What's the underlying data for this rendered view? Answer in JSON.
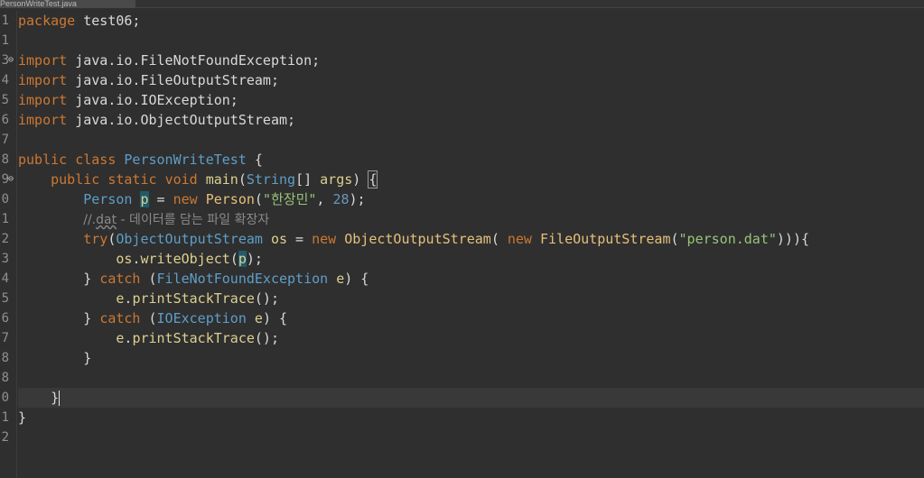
{
  "editor_tab": {
    "label": "PersonWriteTest.java"
  },
  "lines": [
    {
      "n": "1",
      "tokens": [
        {
          "t": "package",
          "c": "kw"
        },
        {
          "t": " test06;",
          "c": "var"
        }
      ]
    },
    {
      "n": "1",
      "tokens": []
    },
    {
      "n": "3",
      "fold": "⊖",
      "tokens": [
        {
          "t": "import",
          "c": "kw"
        },
        {
          "t": " java.io.FileNotFoundException;",
          "c": "var"
        }
      ]
    },
    {
      "n": "4",
      "tokens": [
        {
          "t": "import",
          "c": "kw"
        },
        {
          "t": " java.io.FileOutputStream;",
          "c": "var"
        }
      ]
    },
    {
      "n": "5",
      "tokens": [
        {
          "t": "import",
          "c": "kw"
        },
        {
          "t": " java.io.IOException;",
          "c": "var"
        }
      ]
    },
    {
      "n": "6",
      "tokens": [
        {
          "t": "import",
          "c": "kw"
        },
        {
          "t": " java.io.ObjectOutputStream;",
          "c": "var"
        }
      ]
    },
    {
      "n": "7",
      "tokens": []
    },
    {
      "n": "8",
      "tokens": [
        {
          "t": "public",
          "c": "kw"
        },
        {
          "t": " ",
          "c": "var"
        },
        {
          "t": "class",
          "c": "kw"
        },
        {
          "t": " ",
          "c": "var"
        },
        {
          "t": "PersonWriteTest",
          "c": "type"
        },
        {
          "t": " {",
          "c": "var"
        }
      ]
    },
    {
      "n": "9",
      "fold": "⊖",
      "tokens": [
        {
          "t": "    ",
          "c": "var"
        },
        {
          "t": "public",
          "c": "kw"
        },
        {
          "t": " ",
          "c": "var"
        },
        {
          "t": "static",
          "c": "kw"
        },
        {
          "t": " ",
          "c": "var"
        },
        {
          "t": "void",
          "c": "kw"
        },
        {
          "t": " ",
          "c": "var"
        },
        {
          "t": "main",
          "c": "fn"
        },
        {
          "t": "(",
          "c": "var"
        },
        {
          "t": "String",
          "c": "type"
        },
        {
          "t": "[] ",
          "c": "var"
        },
        {
          "t": "args",
          "c": "fn"
        },
        {
          "t": ") ",
          "c": "var"
        },
        {
          "t": "{",
          "c": "brace"
        }
      ]
    },
    {
      "n": "0",
      "tokens": [
        {
          "t": "        ",
          "c": "var"
        },
        {
          "t": "Person",
          "c": "type"
        },
        {
          "t": " ",
          "c": "var"
        },
        {
          "t": "p",
          "c": "hlvar"
        },
        {
          "t": " = ",
          "c": "var"
        },
        {
          "t": "new",
          "c": "kw"
        },
        {
          "t": " ",
          "c": "var"
        },
        {
          "t": "Person",
          "c": "cls"
        },
        {
          "t": "(",
          "c": "var"
        },
        {
          "t": "\"한장민\"",
          "c": "str"
        },
        {
          "t": ", ",
          "c": "var"
        },
        {
          "t": "28",
          "c": "num"
        },
        {
          "t": ");",
          "c": "var"
        }
      ]
    },
    {
      "n": "1",
      "tokens": [
        {
          "t": "        ",
          "c": "var"
        },
        {
          "t": "//.",
          "c": "com"
        },
        {
          "t": "dat",
          "c": "comsq"
        },
        {
          "t": " - 데이터를 담는 파일 확장자",
          "c": "com"
        }
      ]
    },
    {
      "n": "2",
      "tokens": [
        {
          "t": "        ",
          "c": "var"
        },
        {
          "t": "try",
          "c": "kw"
        },
        {
          "t": "(",
          "c": "var"
        },
        {
          "t": "ObjectOutputStream",
          "c": "type"
        },
        {
          "t": " ",
          "c": "var"
        },
        {
          "t": "os",
          "c": "fn"
        },
        {
          "t": " = ",
          "c": "var"
        },
        {
          "t": "new",
          "c": "kw"
        },
        {
          "t": " ",
          "c": "var"
        },
        {
          "t": "ObjectOutputStream",
          "c": "cls"
        },
        {
          "t": "( ",
          "c": "var"
        },
        {
          "t": "new",
          "c": "kw"
        },
        {
          "t": " ",
          "c": "var"
        },
        {
          "t": "FileOutputStream",
          "c": "cls"
        },
        {
          "t": "(",
          "c": "var"
        },
        {
          "t": "\"person.dat\"",
          "c": "str"
        },
        {
          "t": "))){",
          "c": "var"
        }
      ]
    },
    {
      "n": "3",
      "tokens": [
        {
          "t": "            ",
          "c": "var"
        },
        {
          "t": "os",
          "c": "fn"
        },
        {
          "t": ".",
          "c": "var"
        },
        {
          "t": "writeObject",
          "c": "fn"
        },
        {
          "t": "(",
          "c": "var"
        },
        {
          "t": "p",
          "c": "hlvar"
        },
        {
          "t": ");",
          "c": "var"
        }
      ]
    },
    {
      "n": "4",
      "tokens": [
        {
          "t": "        } ",
          "c": "var"
        },
        {
          "t": "catch",
          "c": "kw"
        },
        {
          "t": " (",
          "c": "var"
        },
        {
          "t": "FileNotFoundException",
          "c": "type"
        },
        {
          "t": " ",
          "c": "var"
        },
        {
          "t": "e",
          "c": "fn"
        },
        {
          "t": ") {",
          "c": "var"
        }
      ]
    },
    {
      "n": "5",
      "tokens": [
        {
          "t": "            ",
          "c": "var"
        },
        {
          "t": "e",
          "c": "fn"
        },
        {
          "t": ".",
          "c": "var"
        },
        {
          "t": "printStackTrace",
          "c": "fn"
        },
        {
          "t": "();",
          "c": "var"
        }
      ]
    },
    {
      "n": "6",
      "tokens": [
        {
          "t": "        } ",
          "c": "var"
        },
        {
          "t": "catch",
          "c": "kw"
        },
        {
          "t": " (",
          "c": "var"
        },
        {
          "t": "IOException",
          "c": "type"
        },
        {
          "t": " ",
          "c": "var"
        },
        {
          "t": "e",
          "c": "fn"
        },
        {
          "t": ") {",
          "c": "var"
        }
      ]
    },
    {
      "n": "7",
      "tokens": [
        {
          "t": "            ",
          "c": "var"
        },
        {
          "t": "e",
          "c": "fn"
        },
        {
          "t": ".",
          "c": "var"
        },
        {
          "t": "printStackTrace",
          "c": "fn"
        },
        {
          "t": "();",
          "c": "var"
        }
      ]
    },
    {
      "n": "8",
      "tokens": [
        {
          "t": "        }",
          "c": "var"
        }
      ]
    },
    {
      "n": "8",
      "tokens": []
    },
    {
      "n": "0",
      "current": true,
      "tokens": [
        {
          "t": "    }",
          "c": "var"
        }
      ]
    },
    {
      "n": "1",
      "tokens": [
        {
          "t": "}",
          "c": "var"
        }
      ]
    },
    {
      "n": "2",
      "tokens": []
    }
  ]
}
